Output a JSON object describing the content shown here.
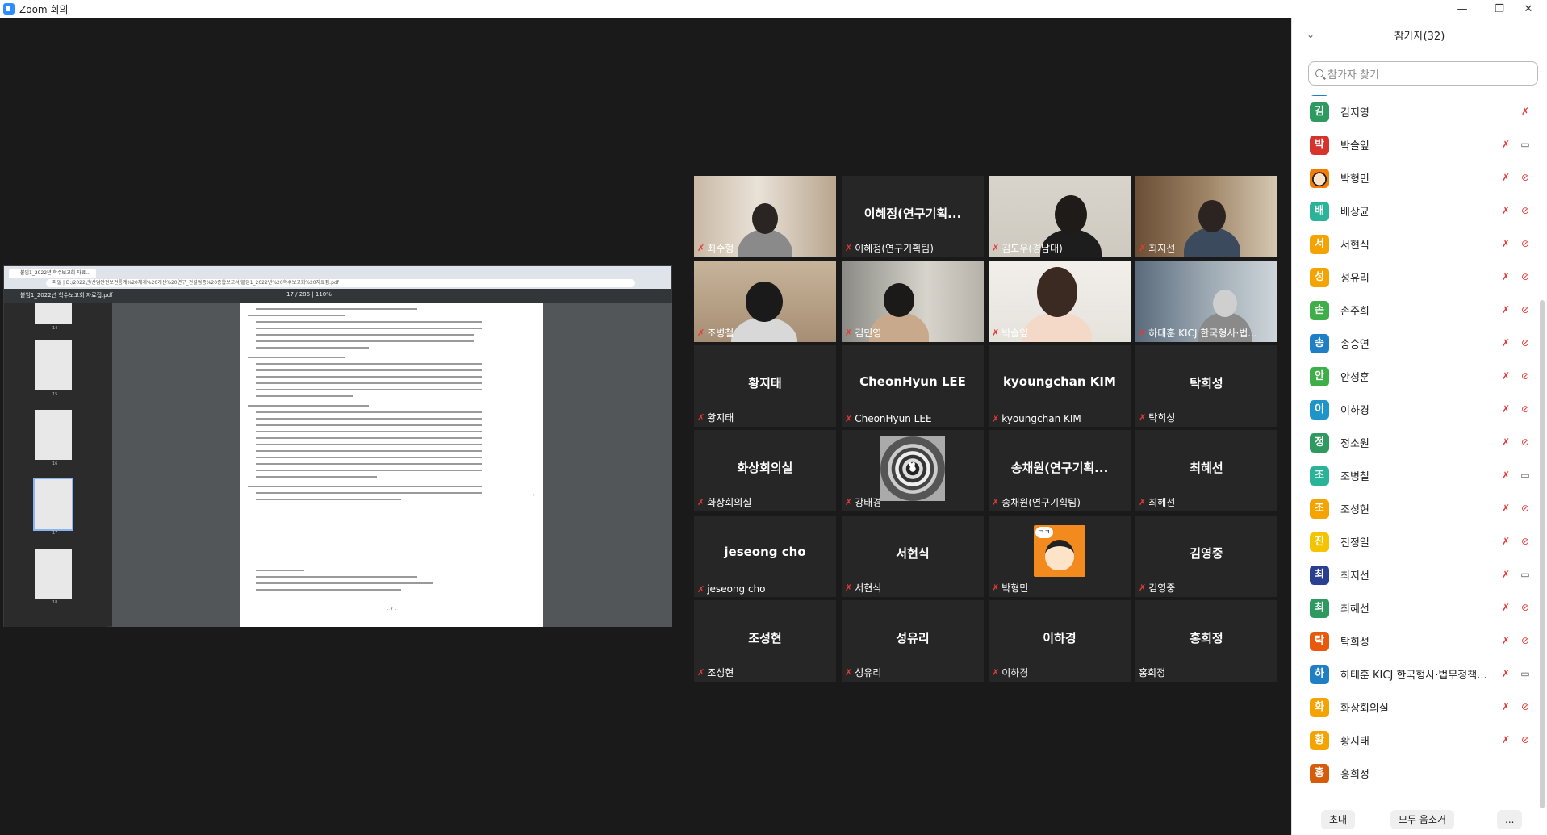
{
  "window": {
    "title": "Zoom 회의",
    "minimize": "—",
    "restore": "❐",
    "close": "✕"
  },
  "share": {
    "tab_label": "붙임1_2022년 학수보고회 자료…",
    "url": "파일 | D:/2022년/산업안전보건통계%20체계%20개선%20연구_건설업종%20종합보고서/붙임1_2022년%20학수보고회%20자료집.pdf",
    "pdf_name": "붙임1_2022년 학수보고회 자료집.pdf",
    "page_indicator": "17 / 286  |  110%",
    "thumb_labels": [
      "14",
      "15",
      "16",
      "17",
      "18"
    ],
    "page_number": "- 7 -",
    "next_chevron": "›"
  },
  "tiles": [
    {
      "name": "최수형",
      "has_video": true
    },
    {
      "name": "이혜정(연구기획팀)",
      "center": "이혜정(연구기획...",
      "has_video": false
    },
    {
      "name": "김도우(경남대)",
      "has_video": true,
      "speaker": true
    },
    {
      "name": "최지선",
      "has_video": true
    },
    {
      "name": "조병철",
      "has_video": true
    },
    {
      "name": "김민영",
      "has_video": true
    },
    {
      "name": "박솔잎",
      "has_video": true
    },
    {
      "name": "하태훈 KICJ 한국형사·법...",
      "has_video": true
    },
    {
      "name": "황지태",
      "center": "황지태",
      "has_video": false
    },
    {
      "name": "CheonHyun LEE",
      "center": "CheonHyun LEE",
      "has_video": false
    },
    {
      "name": "kyoungchan KIM",
      "center": "kyoungchan KIM",
      "has_video": false
    },
    {
      "name": "탁희성",
      "center": "탁희성",
      "has_video": false
    },
    {
      "name": "화상회의실",
      "center": "화상회의실",
      "has_video": false
    },
    {
      "name": "강태경",
      "has_video": false,
      "has_avatar": true
    },
    {
      "name": "송채원(연구기획팀)",
      "center": "송채원(연구기획...",
      "has_video": false
    },
    {
      "name": "최혜선",
      "center": "최혜선",
      "has_video": false
    },
    {
      "name": "jeseong cho",
      "center": "jeseong cho",
      "has_video": false
    },
    {
      "name": "서현식",
      "center": "서현식",
      "has_video": false
    },
    {
      "name": "박형민",
      "has_video": false,
      "has_avatar": true,
      "avatar_text": "ㅋㅋ"
    },
    {
      "name": "김영중",
      "center": "김영중",
      "has_video": false
    },
    {
      "name": "조성현",
      "center": "조성현",
      "has_video": false
    },
    {
      "name": "성유리",
      "center": "성유리",
      "has_video": false
    },
    {
      "name": "이하경",
      "center": "이하경",
      "has_video": false
    },
    {
      "name": "홍희정",
      "center": "홍희정",
      "has_video": false,
      "unmuted": true
    }
  ],
  "participants_panel": {
    "title": "참가자(32)",
    "collapse_icon": "⌄",
    "search_placeholder": "참가자 찾기",
    "items": [
      {
        "initial": "김",
        "name": "김지영",
        "color": "#2e9a5f",
        "cam": "none"
      },
      {
        "initial": "박",
        "name": "박솔잎",
        "color": "#d6332c",
        "cam": "on"
      },
      {
        "initial": "",
        "name": "박형민",
        "color": "#f57c00",
        "cam": "off",
        "photo": true
      },
      {
        "initial": "배",
        "name": "배상균",
        "color": "#2bb39a",
        "cam": "off"
      },
      {
        "initial": "서",
        "name": "서현식",
        "color": "#f5a300",
        "cam": "off"
      },
      {
        "initial": "성",
        "name": "성유리",
        "color": "#f5a300",
        "cam": "off"
      },
      {
        "initial": "손",
        "name": "손주희",
        "color": "#3fae49",
        "cam": "off"
      },
      {
        "initial": "송",
        "name": "송승연",
        "color": "#1f7fc4",
        "cam": "off"
      },
      {
        "initial": "안",
        "name": "안성훈",
        "color": "#3fae49",
        "cam": "off"
      },
      {
        "initial": "이",
        "name": "이하경",
        "color": "#1f94c9",
        "cam": "off"
      },
      {
        "initial": "정",
        "name": "정소원",
        "color": "#2e9a5f",
        "cam": "off"
      },
      {
        "initial": "조",
        "name": "조병철",
        "color": "#2bb39a",
        "cam": "on"
      },
      {
        "initial": "조",
        "name": "조성현",
        "color": "#f5a300",
        "cam": "off"
      },
      {
        "initial": "진",
        "name": "진정일",
        "color": "#f5c400",
        "cam": "off"
      },
      {
        "initial": "최",
        "name": "최지선",
        "color": "#2a3f8f",
        "cam": "on"
      },
      {
        "initial": "최",
        "name": "최혜선",
        "color": "#2e9a5f",
        "cam": "off"
      },
      {
        "initial": "탁",
        "name": "탁희성",
        "color": "#e8590c",
        "cam": "off"
      },
      {
        "initial": "하",
        "name": "하태훈 KICJ 한국형사·법무정책...",
        "color": "#1f7fc4",
        "cam": "on"
      },
      {
        "initial": "화",
        "name": "화상회의실",
        "color": "#f5a300",
        "cam": "off"
      },
      {
        "initial": "황",
        "name": "황지태",
        "color": "#f5a300",
        "cam": "off"
      },
      {
        "initial": "홍",
        "name": "홍희정",
        "color": "#d65c0c",
        "cam": "none",
        "nomic": true
      }
    ],
    "footer": {
      "invite": "초대",
      "mute_all": "모두 음소거",
      "more": "..."
    }
  },
  "icons": {
    "muted_mic": "🎙",
    "muted_mic_glyph": "✗",
    "camera_on": "▭",
    "camera_off": "⊘"
  }
}
